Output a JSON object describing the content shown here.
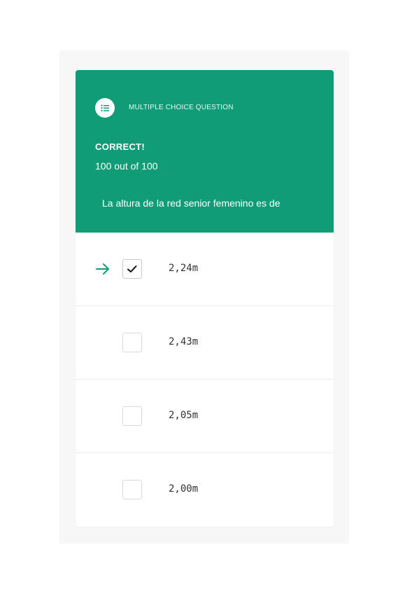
{
  "header": {
    "type_label": "MULTIPLE CHOICE QUESTION",
    "type_icon": "list-check-icon",
    "result_title": "CORRECT!",
    "result_score": "100 out of 100",
    "question": "La altura de la red senior femenino es de"
  },
  "options": [
    {
      "label": "2,24m",
      "checked": true,
      "selected_marker": "arrow-right-icon"
    },
    {
      "label": "2,43m",
      "checked": false
    },
    {
      "label": "2,05m",
      "checked": false
    },
    {
      "label": "2,00m",
      "checked": false
    }
  ],
  "colors": {
    "accent": "#119c78",
    "header_text": "#ffffff",
    "background": "#f7f7f7",
    "option_text": "#333333"
  }
}
